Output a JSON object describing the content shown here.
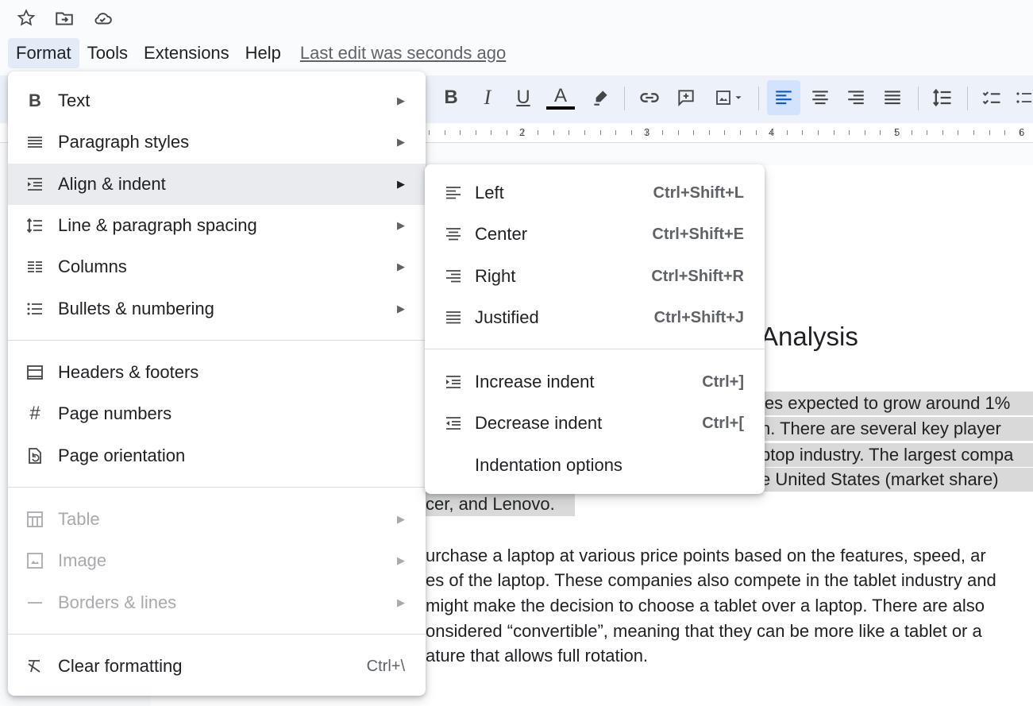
{
  "header_icons": [
    "star-icon",
    "move-to-folder-icon",
    "cloud-saved-icon"
  ],
  "menubar": {
    "items": [
      "Format",
      "Tools",
      "Extensions",
      "Help"
    ],
    "last_edit": "Last edit was seconds ago"
  },
  "toolbar": {
    "bold": "B",
    "italic": "I",
    "underline": "U",
    "text_color": "A"
  },
  "ruler": {
    "numbers": [
      "2",
      "3",
      "4",
      "5",
      "6"
    ]
  },
  "format_menu": {
    "items": [
      {
        "label": "Text",
        "icon": "bold-icon",
        "has_submenu": true
      },
      {
        "label": "Paragraph styles",
        "icon": "paragraph-styles-icon",
        "has_submenu": true
      },
      {
        "label": "Align & indent",
        "icon": "align-indent-icon",
        "has_submenu": true
      },
      {
        "label": "Line & paragraph spacing",
        "icon": "line-spacing-icon",
        "has_submenu": true
      },
      {
        "label": "Columns",
        "icon": "columns-icon",
        "has_submenu": true
      },
      {
        "label": "Bullets & numbering",
        "icon": "bullets-icon",
        "has_submenu": true
      },
      {
        "label": "Headers & footers",
        "icon": "headers-footers-icon",
        "has_submenu": false
      },
      {
        "label": "Page numbers",
        "icon": "hash-icon",
        "has_submenu": false
      },
      {
        "label": "Page orientation",
        "icon": "page-orientation-icon",
        "has_submenu": false
      },
      {
        "label": "Table",
        "icon": "table-icon",
        "has_submenu": true,
        "disabled": true
      },
      {
        "label": "Image",
        "icon": "image-icon",
        "has_submenu": true,
        "disabled": true
      },
      {
        "label": "Borders & lines",
        "icon": "borders-icon",
        "has_submenu": true,
        "disabled": true
      },
      {
        "label": "Clear formatting",
        "icon": "clear-formatting-icon",
        "shortcut": "Ctrl+\\"
      }
    ]
  },
  "align_submenu": {
    "items": [
      {
        "label": "Left",
        "icon": "align-left-icon",
        "shortcut": "Ctrl+Shift+L"
      },
      {
        "label": "Center",
        "icon": "align-center-icon",
        "shortcut": "Ctrl+Shift+E"
      },
      {
        "label": "Right",
        "icon": "align-right-icon",
        "shortcut": "Ctrl+Shift+R"
      },
      {
        "label": "Justified",
        "icon": "align-justify-icon",
        "shortcut": "Ctrl+Shift+J"
      },
      {
        "label": "Increase indent",
        "icon": "increase-indent-icon",
        "shortcut": "Ctrl+]"
      },
      {
        "label": "Decrease indent",
        "icon": "decrease-indent-icon",
        "shortcut": "Ctrl+["
      },
      {
        "label": "Indentation options"
      }
    ]
  },
  "document": {
    "title_fragment": "Analysis",
    "para1": [
      "les expected to grow around 1%",
      "n.  There are several key player",
      "ptop industry.  The largest compa",
      "e United States (market share)",
      "cer, and Lenovo."
    ],
    "para2": [
      "urchase a laptop at various price points based on the features, speed, ar",
      "es of the laptop. These companies also compete in the tablet industry and",
      "might make the decision to choose a tablet over a laptop.  There are also",
      "onsidered “convertible”, meaning that they can be more like a tablet or a",
      "ature that allows full rotation."
    ]
  }
}
